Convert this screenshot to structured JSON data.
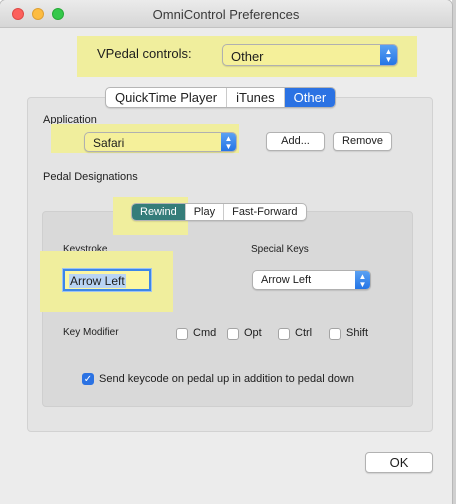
{
  "window": {
    "title": "OmniControl Preferences"
  },
  "vpedal": {
    "label": "VPedal controls:",
    "selected": "Other"
  },
  "main_tabs": [
    {
      "label": "QuickTime Player",
      "selected": false
    },
    {
      "label": "iTunes",
      "selected": false
    },
    {
      "label": "Other",
      "selected": true
    }
  ],
  "application": {
    "label": "Application",
    "selected": "Safari",
    "add_label": "Add...",
    "remove_label": "Remove"
  },
  "pedal": {
    "label": "Pedal Designations",
    "tabs": [
      {
        "label": "Rewind",
        "selected": true
      },
      {
        "label": "Play",
        "selected": false
      },
      {
        "label": "Fast-Forward",
        "selected": false
      }
    ]
  },
  "keystroke": {
    "label": "Keystroke",
    "value": "Arrow Left"
  },
  "special_keys": {
    "label": "Special Keys",
    "selected": "Arrow Left"
  },
  "modifiers": {
    "label": "Key Modifier",
    "items": [
      {
        "label": "Cmd",
        "checked": false
      },
      {
        "label": "Opt",
        "checked": false
      },
      {
        "label": "Ctrl",
        "checked": false
      },
      {
        "label": "Shift",
        "checked": false
      }
    ]
  },
  "keycode_option": {
    "label": "Send keycode on pedal up in addition to pedal down",
    "checked": true
  },
  "ok_label": "OK",
  "colors": {
    "accent": "#2b72e3",
    "highlight": "#f0ee9d",
    "selected_pedal_tab": "#357d7a"
  }
}
